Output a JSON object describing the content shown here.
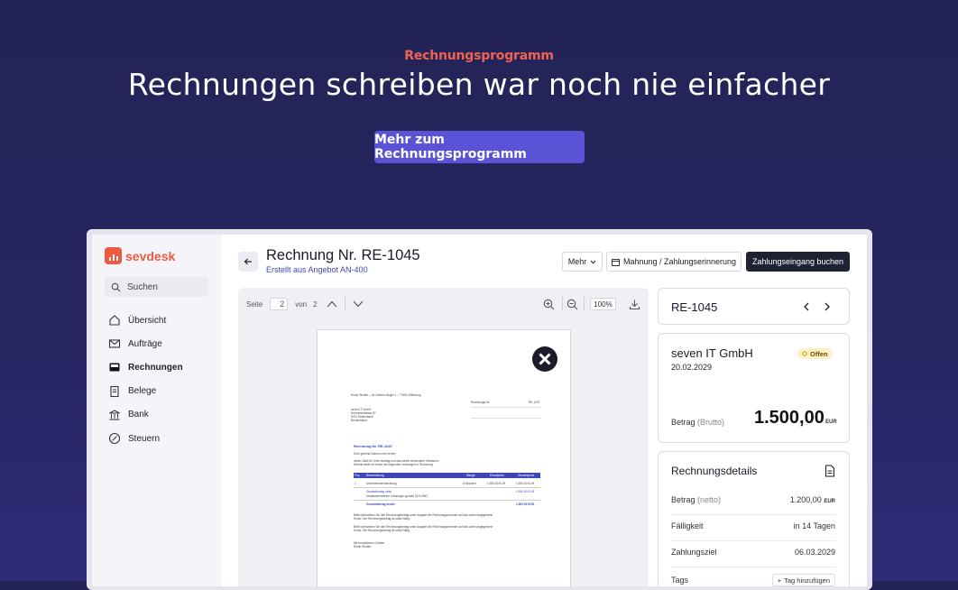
{
  "hero": {
    "eyebrow": "Rechnungsprogramm",
    "title": "Rechnungen schreiben war noch nie einfacher",
    "cta": "Mehr zum Rechnungsprogramm"
  },
  "app": {
    "brand": "sevdesk",
    "search_placeholder": "Suchen",
    "nav": [
      {
        "label": "Übersicht",
        "icon": "home-icon"
      },
      {
        "label": "Aufträge",
        "icon": "mail-icon"
      },
      {
        "label": "Rechnungen",
        "icon": "inbox-icon",
        "active": true
      },
      {
        "label": "Belege",
        "icon": "receipt-icon"
      },
      {
        "label": "Bank",
        "icon": "bank-icon"
      },
      {
        "label": "Steuern",
        "icon": "percent-icon"
      }
    ],
    "header": {
      "title": "Rechnung Nr. RE-1045",
      "subtitle": "Erstellt aus Angebot AN-400",
      "more": "Mehr",
      "reminder": "Mahnung / Zahlungserinnerung",
      "book_payment": "Zahlungseingang buchen"
    },
    "viewer": {
      "page_label": "Seite",
      "page": "2",
      "of_label": "von",
      "total_pages": "2",
      "zoom": "100%"
    },
    "document": {
      "sender_line": "Robin Richter – Im Unteren Angel 1 – 77652 Offenburg",
      "address": [
        "seven IT GmbH",
        "Hermannstrasse 87",
        "6702 Muttenbach",
        "Deutschland"
      ],
      "meta_right": [
        "Rechnungs-Nr.",
        "RE-1047"
      ],
      "heading": "Rechnung Nr. RE-1047",
      "greeting": "Sehr geehrte Damen und Herren,",
      "intro": [
        "vielen Dank für Ihren Auftrag und das damit verbundene Vertrauen!",
        "Hiermit stelle ich Ihnen die folgenden Leistungen in Rechnung:"
      ],
      "table_header": [
        "Pos.",
        "Beschreibung",
        "Menge",
        "Einzelpreis",
        "Gesamtpreis"
      ],
      "table_row": [
        "1",
        "Unternehmensberatung",
        "8 Stunden",
        "1.500,00 EUR",
        "1.500,00 EUR"
      ],
      "totals": [
        "Gesamtbetrag netto",
        "Umsatzsteuerfreie Leistungen gemäß §19 UStG",
        "Gesamtbetrag brutto"
      ],
      "totals_values": [
        "1.500,00 EUR",
        "",
        "1.500,00 EUR"
      ],
      "footer": [
        "Bitte überweisen Sie den Rechnungsbetrag unter Angabe der Rechnungsnummer auf das unten angegebene",
        "Konto. Der Rechnungsbetrag ist sofort fällig.",
        "Mit freundlichen Grüßen",
        "Robin Richter"
      ]
    },
    "summary": {
      "id": "RE-1045",
      "customer": "seven IT GmbH",
      "date": "20.02.2029",
      "status": "Offen",
      "amount_label": "Betrag",
      "amount_hint": "(Brutto)",
      "amount": "1.500,00",
      "currency": "EUR"
    },
    "details": {
      "title": "Rechnungsdetails",
      "rows": [
        {
          "label": "Betrag",
          "hint": "(netto)",
          "value": "1.200,00",
          "unit": "EUR"
        },
        {
          "label": "Fälligkeit",
          "value": "in 14 Tagen"
        },
        {
          "label": "Zahlungsziel",
          "value": "06.03.2029"
        },
        {
          "label": "Tags",
          "value": "Tag hinzufügen"
        }
      ]
    }
  },
  "colors": {
    "accent": "#5b53d6",
    "brand": "#ee5a3f",
    "eyebrow": "#f0634f",
    "background": "#242458"
  }
}
